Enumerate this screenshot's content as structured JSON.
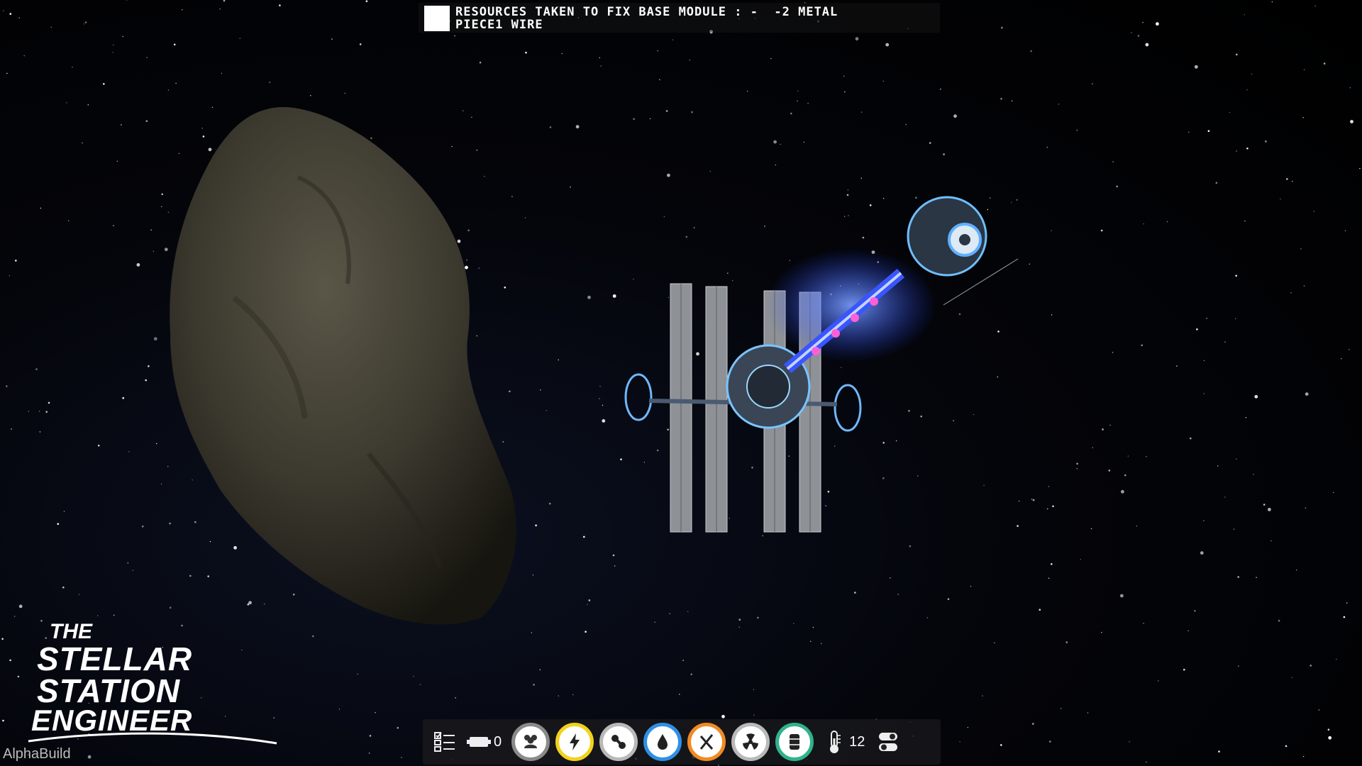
{
  "notification": {
    "message": "RESOURCES TAKEN TO FIX BASE MODULE : -  -2 METAL\nPIECE1 WIRE"
  },
  "logo": {
    "line1": "THE",
    "line2": "STELLAR",
    "line3": "STATION",
    "line4": "ENGINEER"
  },
  "build_label": "AlphaBuild",
  "hud": {
    "battery_count": "0",
    "temperature_value": "12",
    "stat_buttons": [
      {
        "name": "population",
        "icon": "people-icon",
        "ring_color": "#8a8a8a"
      },
      {
        "name": "power",
        "icon": "lightning-icon",
        "ring_color": "#f2d21b"
      },
      {
        "name": "network",
        "icon": "link-icon",
        "ring_color": "#b9b9b9"
      },
      {
        "name": "water",
        "icon": "water-drop-icon",
        "ring_color": "#2f8fe6"
      },
      {
        "name": "food",
        "icon": "utensils-icon",
        "ring_color": "#f08a24"
      },
      {
        "name": "radiation",
        "icon": "radiation-icon",
        "ring_color": "#b9b9b9"
      },
      {
        "name": "storage",
        "icon": "barrel-icon",
        "ring_color": "#2fb38a"
      }
    ]
  }
}
